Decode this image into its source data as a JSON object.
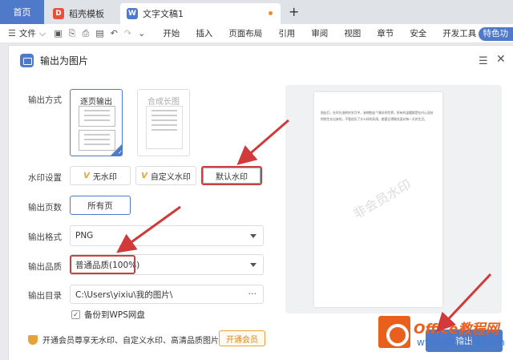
{
  "tabs": {
    "home": "首页",
    "template": "稻壳模板",
    "document": "文字文稿1",
    "new_tab": "+"
  },
  "toolbar": {
    "file": "文件",
    "items": [
      "开始",
      "插入",
      "页面布局",
      "引用",
      "审阅",
      "视图",
      "章节",
      "安全",
      "开发工具"
    ],
    "special": "特色功"
  },
  "dialog": {
    "title": "输出为图片",
    "labels": {
      "mode": "输出方式",
      "watermark": "水印设置",
      "pages": "输出页数",
      "format": "输出格式",
      "quality": "输出品质",
      "directory": "输出目录"
    },
    "mode_options": [
      "逐页输出",
      "合成长图"
    ],
    "watermark_options": [
      "无水印",
      "自定义水印",
      "默认水印"
    ],
    "pages_value": "所有页",
    "format_value": "PNG",
    "quality_value": "普通品质(100%)",
    "directory_value": "C:\\Users\\yixiu\\我的图片\\",
    "directory_more": "···",
    "backup_label": "备份到WPS网盘",
    "footer_text": "开通会员尊享无水印、自定义水印、高清品质图片",
    "vip_button": "开通会员",
    "output_button": "输出"
  },
  "preview": {
    "text": "朋友们，在时光流转的岁月中，来拥抱这个美好的世界。所有的温暖都是在内心深处悄悄生长出来的，不管经历了什么样的风雨，都要记得微笑面对每一天的生活。",
    "watermark": "非会员水印"
  },
  "logo": {
    "brand": "Office教程网",
    "url": "www.office26.com"
  },
  "colors": {
    "accent": "#4f79c9",
    "highlight": "#c84242",
    "vip": "#e8a23a"
  }
}
